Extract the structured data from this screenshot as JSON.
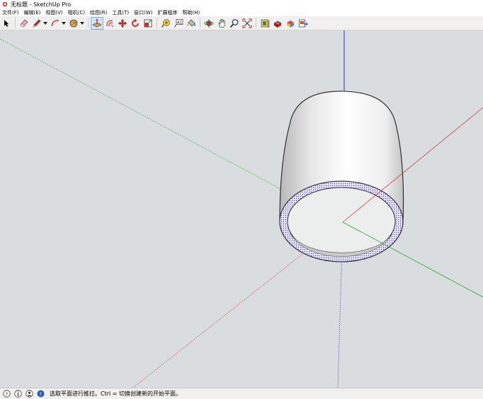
{
  "window": {
    "title": "无标题 - SketchUp Pro"
  },
  "menu": [
    {
      "label": "文件(F)"
    },
    {
      "label": "编辑(E)"
    },
    {
      "label": "视图(V)"
    },
    {
      "label": "相机(C)"
    },
    {
      "label": "绘图(R)"
    },
    {
      "label": "工具(T)"
    },
    {
      "label": "窗口(W)"
    },
    {
      "label": "扩展程序"
    },
    {
      "label": "帮助(H)"
    }
  ],
  "toolbar": {
    "tools": [
      {
        "name": "select-tool",
        "icon": "arrow-cursor-icon",
        "active": false
      },
      {
        "name": "eraser-tool",
        "icon": "eraser-icon",
        "active": false
      },
      {
        "name": "line-tool",
        "icon": "pencil-icon",
        "active": false
      },
      {
        "name": "arc-tool",
        "icon": "arc-icon",
        "active": false
      },
      {
        "name": "shape-tool",
        "icon": "circle-icon",
        "active": false
      },
      {
        "name": "push-pull-tool",
        "icon": "push-pull-icon",
        "active": true
      },
      {
        "name": "offset-tool",
        "icon": "offset-icon",
        "active": false
      },
      {
        "name": "move-tool",
        "icon": "move-icon",
        "active": false
      },
      {
        "name": "rotate-tool",
        "icon": "rotate-icon",
        "active": false
      },
      {
        "name": "scale-tool",
        "icon": "scale-icon",
        "active": false
      },
      {
        "name": "tape-measure-tool",
        "icon": "tape-measure-icon",
        "active": false
      },
      {
        "name": "text-tool",
        "icon": "text-icon",
        "active": false
      },
      {
        "name": "paint-bucket-tool",
        "icon": "paint-bucket-icon",
        "active": false
      },
      {
        "name": "orbit-tool",
        "icon": "orbit-icon",
        "active": false
      },
      {
        "name": "pan-tool",
        "icon": "hand-icon",
        "active": false
      },
      {
        "name": "zoom-tool",
        "icon": "magnifier-icon",
        "active": false
      },
      {
        "name": "zoom-extents-tool",
        "icon": "zoom-extents-icon",
        "active": false
      },
      {
        "name": "3d-warehouse-tool",
        "icon": "warehouse-icon",
        "active": false
      },
      {
        "name": "extension-warehouse-tool",
        "icon": "extension-icon",
        "active": false
      },
      {
        "name": "sketchup-layout-tool",
        "icon": "layout-icon",
        "active": false
      },
      {
        "name": "send-to-layout-tool",
        "icon": "send-to-layout-icon",
        "active": false
      }
    ]
  },
  "status": {
    "text": "选取平面进行推拉。Ctrl = 切换创建新的开始平面。"
  },
  "colors": {
    "viewport_bg": "#d9dde0",
    "axis_red": "#d23a3a",
    "axis_green": "#2da52d",
    "axis_blue": "#2b39c8",
    "active_tool_bg": "#cfe3f7"
  }
}
